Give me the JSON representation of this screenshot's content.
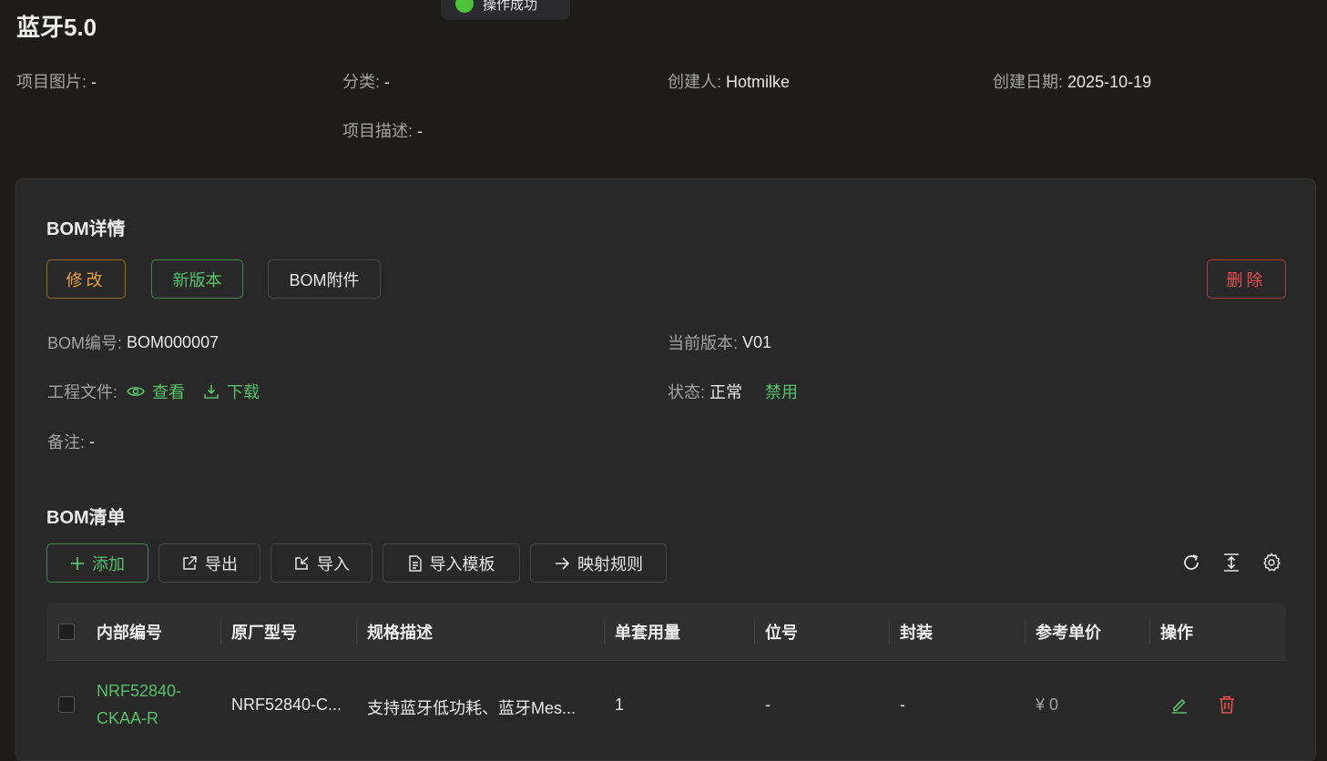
{
  "toast": {
    "text": "操作成功"
  },
  "page": {
    "title": "蓝牙5.0"
  },
  "project_meta": {
    "image_label": "项目图片:",
    "image_value": "-",
    "category_label": "分类:",
    "category_value": "-",
    "creator_label": "创建人:",
    "creator_value": "Hotmilke",
    "date_label": "创建日期:",
    "date_value": "2025-10-19",
    "desc_label": "项目描述:",
    "desc_value": "-"
  },
  "bom_detail": {
    "title": "BOM详情",
    "edit_label": "修改",
    "new_version_label": "新版本",
    "attachments_label": "BOM附件",
    "delete_label": "删除",
    "bom_no_label": "BOM编号:",
    "bom_no_value": "BOM000007",
    "version_label": "当前版本:",
    "version_value": "V01",
    "eng_file_label": "工程文件:",
    "view_label": "查看",
    "download_label": "下载",
    "status_label": "状态:",
    "status_value": "正常",
    "disable_label": "禁用",
    "remark_label": "备注:",
    "remark_value": "-"
  },
  "bom_list": {
    "title": "BOM清单",
    "toolbar": {
      "add": "添加",
      "export": "导出",
      "import": "导入",
      "import_template": "导入模板",
      "mapping_rules": "映射规则"
    },
    "columns": [
      "内部编号",
      "原厂型号",
      "规格描述",
      "单套用量",
      "位号",
      "封装",
      "参考单价",
      "操作"
    ],
    "rows": [
      {
        "internal_no": "NRF52840-CKAA-R",
        "part_no": "NRF52840-C...",
        "spec": "支持蓝牙低功耗、蓝牙Mes...",
        "qty": "1",
        "designator": "-",
        "package": "-",
        "price": "¥ 0"
      }
    ]
  },
  "colors": {
    "accent_green": "#56c16a",
    "warning_orange": "#e9a43a",
    "danger_red": "#e85050"
  }
}
